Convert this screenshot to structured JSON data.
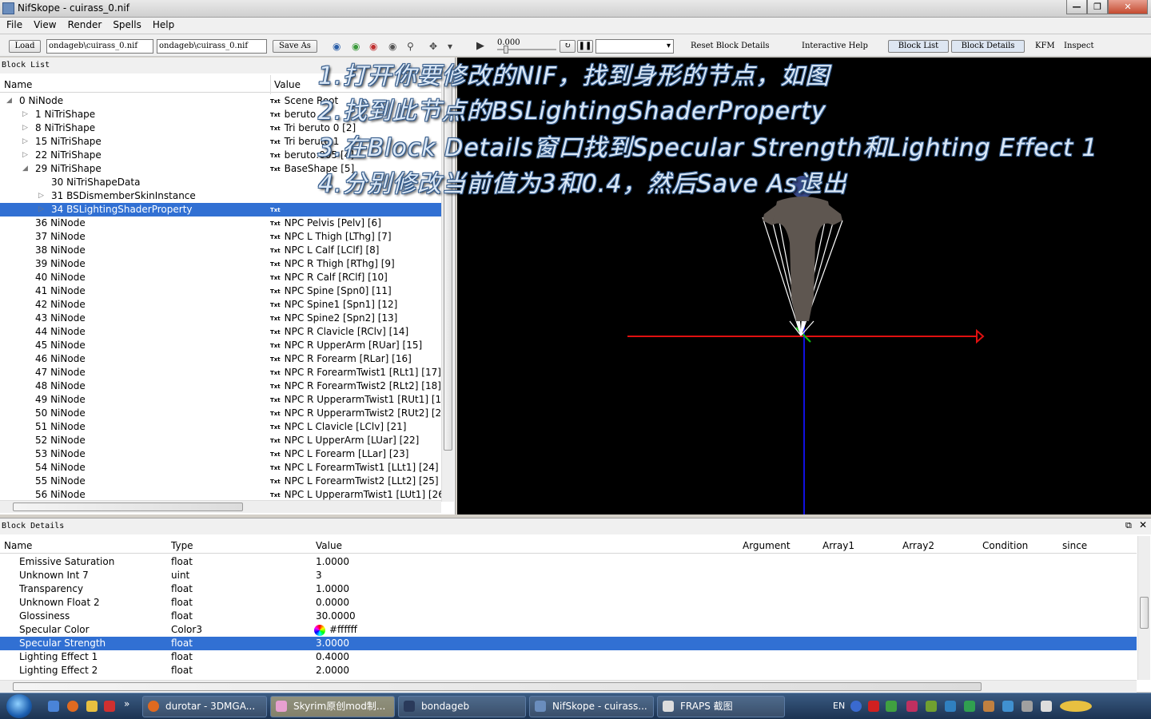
{
  "window": {
    "title": "NifSkope - cuirass_0.nif"
  },
  "menu": [
    "File",
    "View",
    "Render",
    "Spells",
    "Help"
  ],
  "toolbar": {
    "load_label": "Load",
    "load_path": "ondageb\\cuirass_0.nif",
    "save_path": "ondageb\\cuirass_0.nif",
    "save_as_label": "Save As",
    "time_value": "0.000",
    "reset_label": "Reset Block Details",
    "help_label": "Interactive Help",
    "block_list_label": "Block List",
    "block_details_label": "Block Details",
    "kfm_label": "KFM",
    "inspect_label": "Inspect"
  },
  "block_list": {
    "title": "Block List",
    "col_name": "Name",
    "col_value": "Value",
    "rows": [
      {
        "name": "0 NiNode",
        "value": "Scene Root"
      },
      {
        "name": "1 NiTriShape",
        "value": "beruto"
      },
      {
        "name": "8 NiTriShape",
        "value": "Tri beruto 0 [2]"
      },
      {
        "name": "15 NiTriShape",
        "value": "Tri beruto 1"
      },
      {
        "name": "22 NiTriShape",
        "value": "beruto:005 [4]"
      },
      {
        "name": "29 NiTriShape",
        "value": "BaseShape [5]"
      },
      {
        "name": "30 NiTriShapeData",
        "value": ""
      },
      {
        "name": "31 BSDismemberSkinInstance",
        "value": ""
      },
      {
        "name": "34 BSLightingShaderProperty",
        "value": ""
      },
      {
        "name": "36 NiNode",
        "value": "NPC Pelvis [Pelv] [6]"
      },
      {
        "name": "37 NiNode",
        "value": "NPC L Thigh [LThg] [7]"
      },
      {
        "name": "38 NiNode",
        "value": "NPC L Calf [LClf] [8]"
      },
      {
        "name": "39 NiNode",
        "value": "NPC R Thigh [RThg] [9]"
      },
      {
        "name": "40 NiNode",
        "value": "NPC R Calf [RClf] [10]"
      },
      {
        "name": "41 NiNode",
        "value": "NPC Spine [Spn0] [11]"
      },
      {
        "name": "42 NiNode",
        "value": "NPC Spine1 [Spn1] [12]"
      },
      {
        "name": "43 NiNode",
        "value": "NPC Spine2 [Spn2] [13]"
      },
      {
        "name": "44 NiNode",
        "value": "NPC R Clavicle [RClv] [14]"
      },
      {
        "name": "45 NiNode",
        "value": "NPC R UpperArm [RUar] [15]"
      },
      {
        "name": "46 NiNode",
        "value": "NPC R Forearm [RLar] [16]"
      },
      {
        "name": "47 NiNode",
        "value": "NPC R ForearmTwist1 [RLt1] [17]"
      },
      {
        "name": "48 NiNode",
        "value": "NPC R ForearmTwist2 [RLt2] [18]"
      },
      {
        "name": "49 NiNode",
        "value": "NPC R UpperarmTwist1 [RUt1] [1"
      },
      {
        "name": "50 NiNode",
        "value": "NPC R UpperarmTwist2 [RUt2] [2"
      },
      {
        "name": "51 NiNode",
        "value": "NPC L Clavicle [LClv] [21]"
      },
      {
        "name": "52 NiNode",
        "value": "NPC L UpperArm [LUar] [22]"
      },
      {
        "name": "53 NiNode",
        "value": "NPC L Forearm [LLar] [23]"
      },
      {
        "name": "54 NiNode",
        "value": "NPC L ForearmTwist1 [LLt1] [24]"
      },
      {
        "name": "55 NiNode",
        "value": "NPC L ForearmTwist2 [LLt2] [25]"
      },
      {
        "name": "56 NiNode",
        "value": "NPC L UpperarmTwist1 [LUt1] [26"
      }
    ],
    "value_tag": "Txt"
  },
  "annotations": [
    "1.打开你要修改的NIF，找到身形的节点，如图",
    "2.找到此节点的BSLightingShaderProperty",
    "3.在Block Details窗口找到Specular Strength和Lighting Effect 1",
    "4.分别修改当前值为3和0.4，然后Save As退出"
  ],
  "block_details": {
    "title": "Block Details",
    "columns": [
      "Name",
      "Type",
      "Value",
      "Argument",
      "Array1",
      "Array2",
      "Condition",
      "since"
    ],
    "rows": [
      {
        "name": "Emissive Saturation",
        "type": "float",
        "value": "1.0000"
      },
      {
        "name": "Unknown Int 7",
        "type": "uint",
        "value": "3"
      },
      {
        "name": "Transparency",
        "type": "float",
        "value": "1.0000"
      },
      {
        "name": "Unknown Float 2",
        "type": "float",
        "value": "0.0000"
      },
      {
        "name": "Glossiness",
        "type": "float",
        "value": "30.0000"
      },
      {
        "name": "Specular Color",
        "type": "Color3",
        "value": "#ffffff"
      },
      {
        "name": "Specular Strength",
        "type": "float",
        "value": "3.0000"
      },
      {
        "name": "Lighting Effect 1",
        "type": "float",
        "value": "0.4000"
      },
      {
        "name": "Lighting Effect 2",
        "type": "float",
        "value": "2.0000"
      }
    ]
  },
  "taskbar": {
    "tasks": [
      "durotar - 3DMGA...",
      "Skyrim原创mod制...",
      "bondageb",
      "NifSkope - cuirass...",
      "FRAPS 截图"
    ],
    "lang": "EN"
  },
  "colors": {
    "selection": "#3170d3",
    "viewport": "#000000",
    "axis_x": "#e01010",
    "axis_y": "#1010e0"
  }
}
